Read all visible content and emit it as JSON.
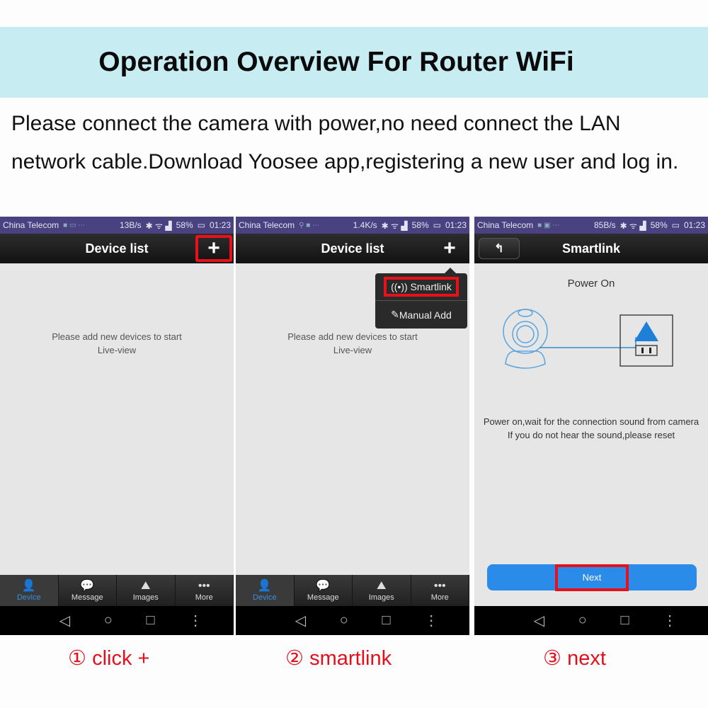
{
  "header": {
    "title": "Operation Overview For Router WiFi"
  },
  "intro": "Please connect the camera with power,no need connect the LAN network cable.Download Yoosee app,registering a new user and log in.",
  "colors": {
    "banner": "#c7ecf2",
    "highlight": "#e8101b",
    "accent": "#2a8be8",
    "step_text": "#e3101b"
  },
  "screens": [
    {
      "status": {
        "carrier": "China Telecom",
        "speed": "13B/s",
        "battery": "58%",
        "time": "01:23"
      },
      "title": "Device list",
      "add_icon": "+",
      "empty_message_line1": "Please add new devices to start",
      "empty_message_line2": "Live-view",
      "tabs": [
        {
          "label": "Device",
          "icon": "person-icon",
          "active": true
        },
        {
          "label": "Message",
          "icon": "chat-icon"
        },
        {
          "label": "Images",
          "icon": "image-icon"
        },
        {
          "label": "More",
          "icon": "more-icon"
        }
      ]
    },
    {
      "status": {
        "carrier": "China Telecom",
        "speed": "1.4K/s",
        "battery": "58%",
        "time": "01:23"
      },
      "title": "Device list",
      "add_icon": "+",
      "menu": {
        "smartlink": "Smartlink",
        "manual_add": "Manual Add"
      },
      "empty_message_line1": "Please add new devices to start",
      "empty_message_line2": "Live-view",
      "tabs": [
        {
          "label": "Device",
          "icon": "person-icon",
          "active": true
        },
        {
          "label": "Message",
          "icon": "chat-icon"
        },
        {
          "label": "Images",
          "icon": "image-icon"
        },
        {
          "label": "More",
          "icon": "more-icon"
        }
      ]
    },
    {
      "status": {
        "carrier": "China Telecom",
        "speed": "85B/s",
        "battery": "58%",
        "time": "01:23"
      },
      "title": "Smartlink",
      "power_title": "Power On",
      "desc_line1": "Power on,wait for the connection sound from camera",
      "desc_line2": "If you do not hear the sound,please reset",
      "next_label": "Next"
    }
  ],
  "steps": [
    {
      "num": "①",
      "label": "click +"
    },
    {
      "num": "②",
      "label": "smartlink"
    },
    {
      "num": "③",
      "label": "next"
    }
  ]
}
